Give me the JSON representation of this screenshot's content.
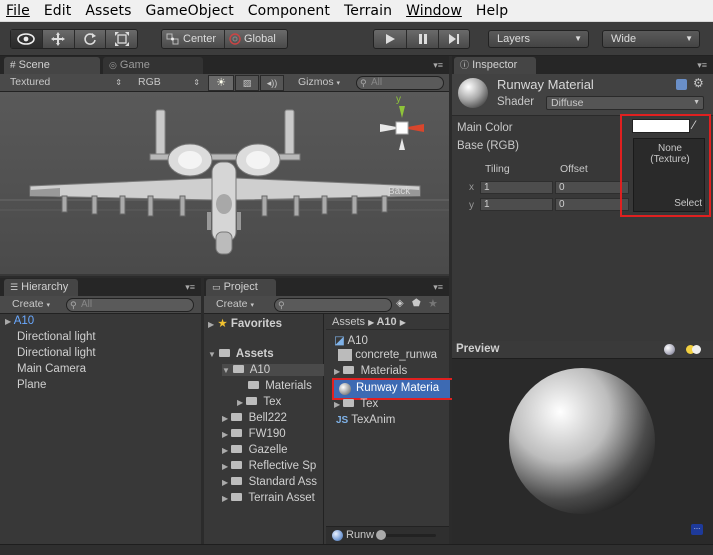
{
  "menu": [
    "File",
    "Edit",
    "Assets",
    "GameObject",
    "Component",
    "Terrain",
    "Window",
    "Help"
  ],
  "toolbar": {
    "pivot_center": "Center",
    "pivot_global": "Global",
    "layers": "Layers",
    "layout": "Wide"
  },
  "scene": {
    "tab_scene": "Scene",
    "tab_game": "Game",
    "shading": "Textured",
    "render_mode": "RGB",
    "gizmos": "Gizmos",
    "search_placeholder": "All",
    "axis_y": "y",
    "view_label": "Back"
  },
  "hierarchy": {
    "tab": "Hierarchy",
    "create": "Create",
    "search_placeholder": "All",
    "items": [
      "A10",
      "Directional light",
      "Directional light",
      "Main Camera",
      "Plane"
    ]
  },
  "project": {
    "tab": "Project",
    "create": "Create",
    "favorites": "Favorites",
    "assets": "Assets",
    "tree": [
      "A10",
      "Materials",
      "Tex",
      "Bell222",
      "FW190",
      "Gazelle",
      "Reflective Sp",
      "Standard Ass",
      "Terrain Asset"
    ],
    "breadcrumb_root": "Assets",
    "breadcrumb_current": "A10",
    "files": [
      "A10",
      "concrete_runwa",
      "Materials",
      "Runway Materia",
      "Tex",
      "TexAnim"
    ],
    "footer_item": "Runw"
  },
  "inspector": {
    "tab": "Inspector",
    "material_name": "Runway Material",
    "shader_label": "Shader",
    "shader_value": "Diffuse",
    "main_color": "Main Color",
    "base_rgb": "Base (RGB)",
    "tiling": "Tiling",
    "offset": "Offset",
    "x_label": "x",
    "y_label": "y",
    "tiling_x": "1",
    "tiling_y": "1",
    "offset_x": "0",
    "offset_y": "0",
    "texture_none": "None",
    "texture_type": "(Texture)",
    "select": "Select",
    "preview": "Preview"
  },
  "colors": {
    "highlight_red": "#e02020",
    "selection_blue": "#3d6ab3",
    "accent_blue": "#6aa9ff"
  }
}
